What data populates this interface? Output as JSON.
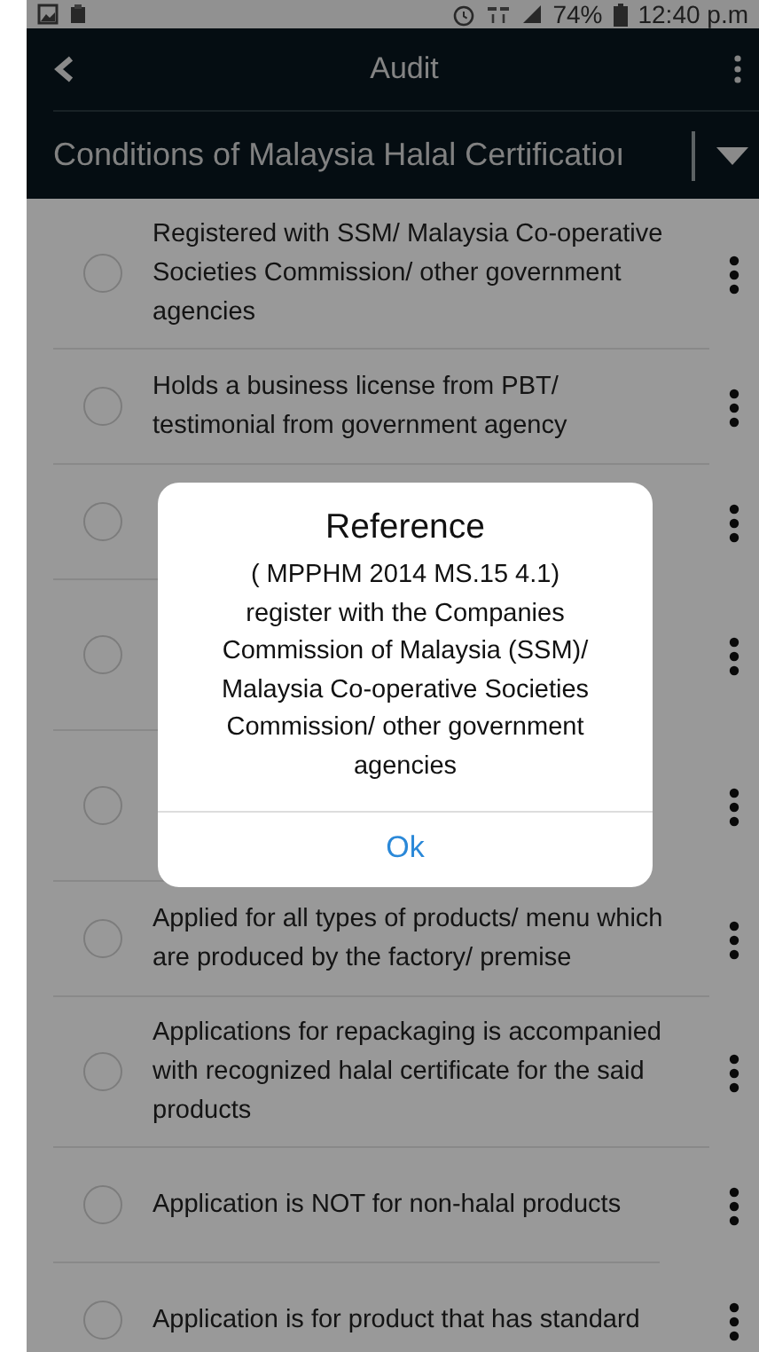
{
  "status_bar": {
    "battery": "74%",
    "time": "12:40 p.m"
  },
  "header": {
    "title": "Audit",
    "section": "Conditions of Malaysia Halal Certificatioı"
  },
  "items": [
    {
      "text": "Registered with SSM/ Malaysia Co-operative Societies Commission/ other government agencies",
      "checked": false
    },
    {
      "text": "Holds a business license from PBT/ testimonial from government agency",
      "checked": false
    },
    {
      "checked": false
    },
    {
      "checked": false
    },
    {
      "checked": false
    },
    {
      "text": "Applied for all types of products/ menu which are produced by the factory/ premise",
      "checked": false
    },
    {
      "text": "Applications for repackaging is accompanied with recognized halal certificate for the said products",
      "checked": false
    },
    {
      "text": "Application is NOT for non-halal products",
      "checked": false
    },
    {
      "text": "Application is for product that has standard",
      "checked": false
    }
  ],
  "dialog": {
    "title": "Reference",
    "body": "( MPPHM 2014 MS.15 4.1) register with the Companies Commission of Malaysia (SSM)/ Malaysia Co-operative Societies Commission/ other government agencies",
    "button": "Ok"
  }
}
